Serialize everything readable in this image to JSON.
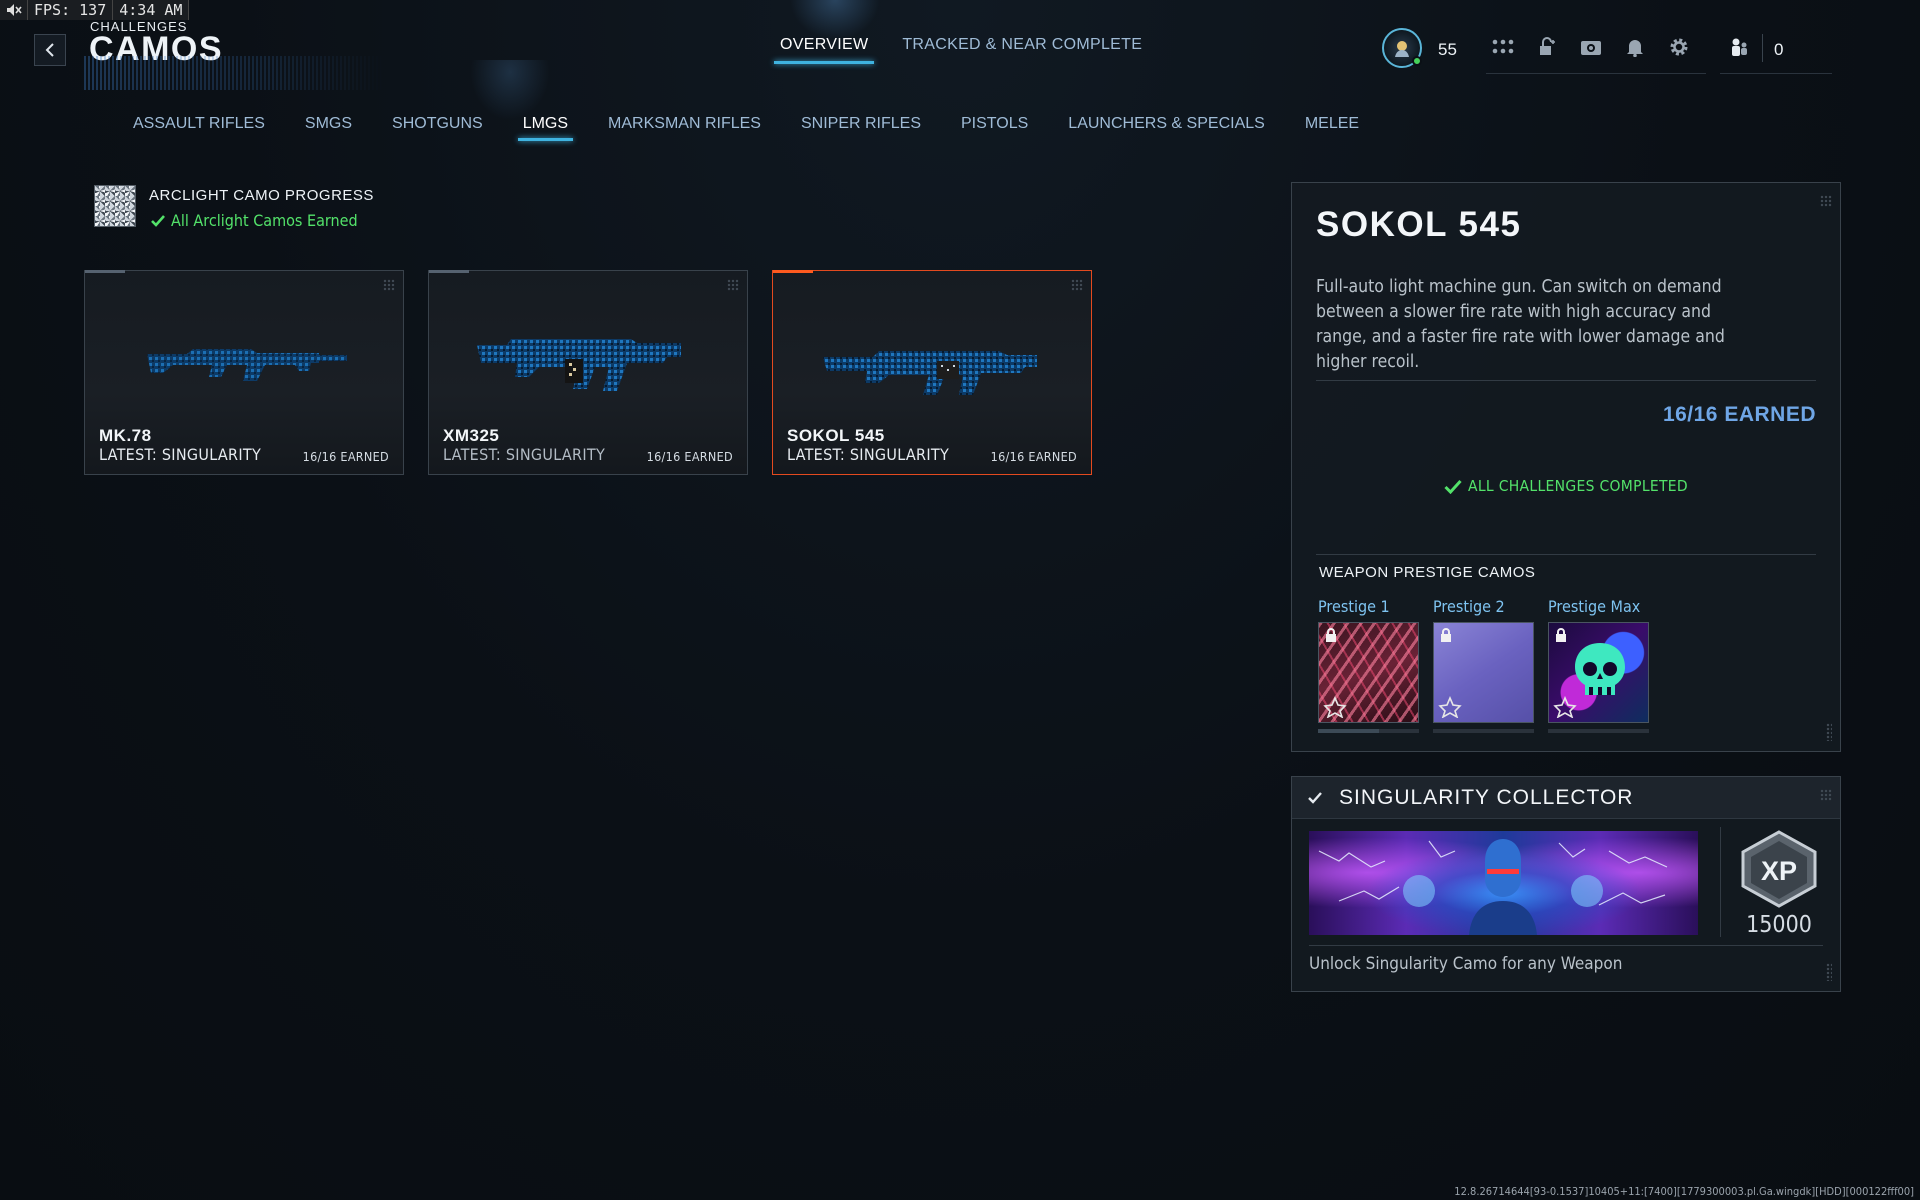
{
  "overlay": {
    "fps": "FPS: 137",
    "time": "4:34 AM"
  },
  "header": {
    "breadcrumb": "CHALLENGES",
    "title": "CAMOS",
    "tabs": [
      {
        "label": "OVERVIEW",
        "active": true
      },
      {
        "label": "TRACKED & NEAR COMPLETE",
        "active": false
      }
    ],
    "player_level": "55",
    "party_count": "0",
    "icons": [
      "apps-grid-icon",
      "unlock-icon",
      "camera-icon",
      "bell-icon",
      "gear-icon"
    ]
  },
  "categories": [
    {
      "label": "ASSAULT RIFLES"
    },
    {
      "label": "SMGS"
    },
    {
      "label": "SHOTGUNS"
    },
    {
      "label": "LMGS",
      "active": true
    },
    {
      "label": "MARKSMAN RIFLES"
    },
    {
      "label": "SNIPER RIFLES"
    },
    {
      "label": "PISTOLS"
    },
    {
      "label": "LAUNCHERS & SPECIALS"
    },
    {
      "label": "MELEE"
    }
  ],
  "arclight": {
    "title": "ARCLIGHT CAMO PROGRESS",
    "status": "All Arclight Camos Earned"
  },
  "weapons": [
    {
      "name": "MK.78",
      "latest": "LATEST: SINGULARITY",
      "earned": "16/16 EARNED"
    },
    {
      "name": "XM325",
      "latest": "LATEST: SINGULARITY",
      "earned": "16/16 EARNED"
    },
    {
      "name": "SOKOL 545",
      "latest": "LATEST: SINGULARITY",
      "earned": "16/16 EARNED",
      "selected": true
    }
  ],
  "detail": {
    "title": "SOKOL 545",
    "description": "Full-auto light machine gun. Can switch on demand between a slower fire rate with high accuracy and range, and a faster fire rate with lower damage and higher recoil.",
    "earned": "16/16 EARNED",
    "completed": "ALL CHALLENGES COMPLETED",
    "prestige_title": "WEAPON PRESTIGE CAMOS",
    "prestige": [
      {
        "label": "Prestige 1",
        "locked": true
      },
      {
        "label": "Prestige 2",
        "locked": true
      },
      {
        "label": "Prestige Max",
        "locked": true
      }
    ]
  },
  "collector": {
    "title": "SINGULARITY COLLECTOR",
    "xp_label": "XP",
    "xp_value": "15000",
    "description": "Unlock Singularity Camo for any Weapon"
  },
  "footer": {
    "version": "12.8.26714644[93-0.1537]10405+11:[7400][1779300003.pl.Ga.wingdk][HDD][000122fff00]"
  },
  "colors": {
    "accent_blue": "#3fb3e0",
    "selected_orange": "#e34a1f",
    "success_green": "#53e26a",
    "earned_blue": "#6fa6e6"
  }
}
